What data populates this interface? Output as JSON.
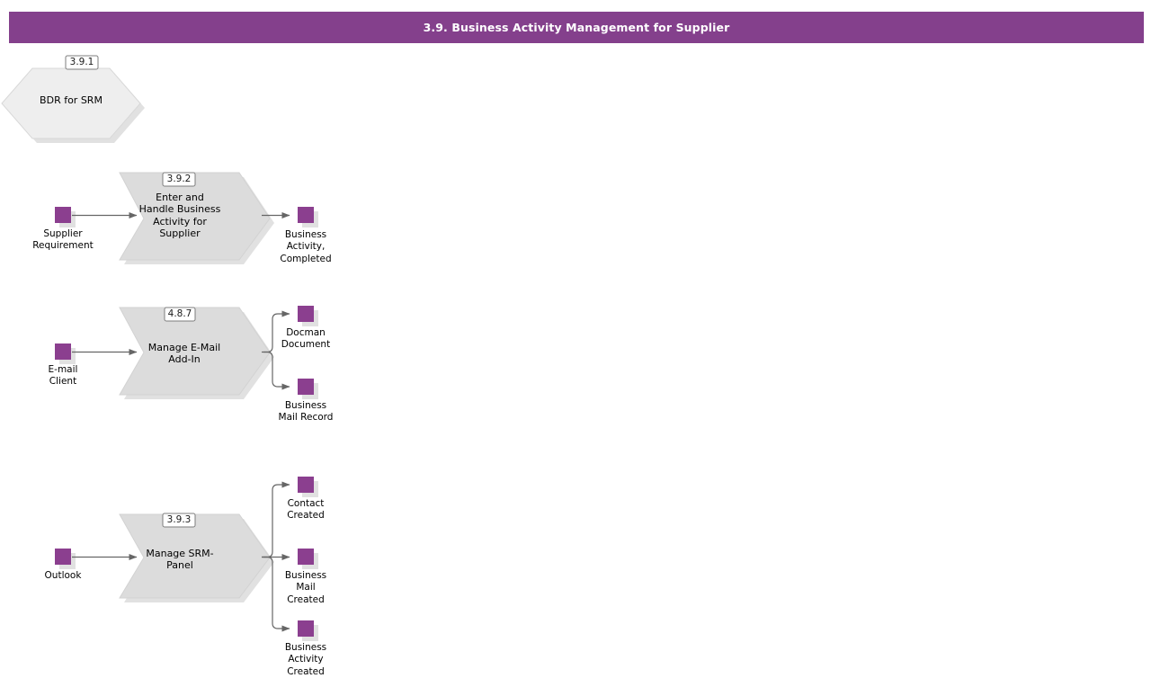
{
  "header": {
    "title": "3.9. Business Activity Management for Supplier",
    "bar_color": "#84408c",
    "text_color": "#ffffff"
  },
  "palette": {
    "accent_purple": "#84408c",
    "io_square": "#8b3f8f",
    "hexagon_fill": "#eeeeee",
    "chevron_fill": "#dcdcdc",
    "shape_border": "#d2d2d2",
    "connector": "#666666",
    "shadow": "#c8c8c8",
    "badge_fill": "#ffffff",
    "badge_border": "#808080"
  },
  "diagram": {
    "type": "process-flow",
    "rows": [
      {
        "id": "row-1",
        "process": {
          "shape": "hexagon",
          "badge": "3.9.1",
          "label": "BDR for SRM"
        },
        "inputs": [],
        "outputs": []
      },
      {
        "id": "row-2",
        "process": {
          "shape": "chevron",
          "badge": "3.9.2",
          "label": "Enter and\nHandle Business\nActivity for\nSupplier"
        },
        "inputs": [
          {
            "icon": "purple-square",
            "label": "Supplier\nRequirement"
          }
        ],
        "outputs": [
          {
            "icon": "purple-square",
            "label": "Business\nActivity,\nCompleted"
          }
        ]
      },
      {
        "id": "row-3",
        "process": {
          "shape": "chevron",
          "badge": "4.8.7",
          "label": "Manage E-Mail\nAdd-In"
        },
        "inputs": [
          {
            "icon": "purple-square",
            "label": "E-mail\nClient"
          }
        ],
        "outputs": [
          {
            "icon": "purple-square",
            "label": "Docman\nDocument"
          },
          {
            "icon": "purple-square",
            "label": "Business\nMail Record"
          }
        ]
      },
      {
        "id": "row-4",
        "process": {
          "shape": "chevron",
          "badge": "3.9.3",
          "label": "Manage SRM-\nPanel"
        },
        "inputs": [
          {
            "icon": "purple-square",
            "label": "Outlook"
          }
        ],
        "outputs": [
          {
            "icon": "purple-square",
            "label": "Contact\nCreated"
          },
          {
            "icon": "purple-square",
            "label": "Business\nMail\nCreated"
          },
          {
            "icon": "purple-square",
            "label": "Business\nActivity\nCreated"
          }
        ]
      }
    ]
  },
  "text": {
    "r1_badge": "3.9.1",
    "r1_proc": "BDR for SRM",
    "r2_badge": "3.9.2",
    "r2_proc": "Enter and\nHandle Business\nActivity for\nSupplier",
    "r2_in1": "Supplier\nRequirement",
    "r2_out1": "Business\nActivity,\nCompleted",
    "r3_badge": "4.8.7",
    "r3_proc": "Manage E-Mail\nAdd-In",
    "r3_in1": "E-mail\nClient",
    "r3_out1": "Docman\nDocument",
    "r3_out2": "Business\nMail Record",
    "r4_badge": "3.9.3",
    "r4_proc": "Manage SRM-\nPanel",
    "r4_in1": "Outlook",
    "r4_out1": "Contact\nCreated",
    "r4_out2": "Business\nMail\nCreated",
    "r4_out3": "Business\nActivity\nCreated"
  }
}
